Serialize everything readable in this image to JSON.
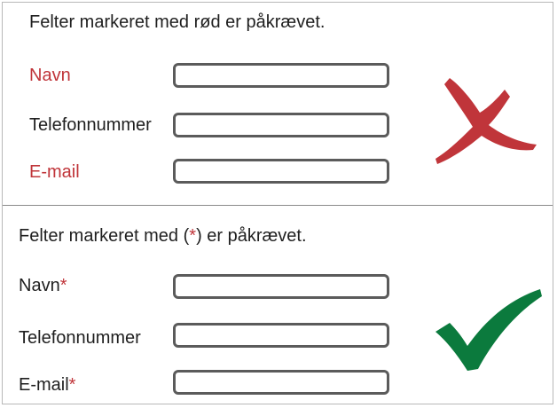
{
  "colors": {
    "required_red": "#c0353a",
    "field_border": "#5b5b5b",
    "cross_red": "#c0353a",
    "check_green": "#0b7a3d"
  },
  "top_example": {
    "heading": "Felter markeret med rød er påkrævet.",
    "fields": [
      {
        "label": "Navn",
        "required": true
      },
      {
        "label": "Telefonnummer",
        "required": false
      },
      {
        "label": "E-mail",
        "required": true
      }
    ],
    "verdict_icon": "red-cross-icon"
  },
  "bottom_example": {
    "heading_before": "Felter markeret med (",
    "heading_asterisk": "*",
    "heading_after": ") er påkrævet.",
    "fields": [
      {
        "label": "Navn",
        "required": true,
        "asterisk": "*"
      },
      {
        "label": "Telefonnummer",
        "required": false,
        "asterisk": ""
      },
      {
        "label": "E-mail",
        "required": true,
        "asterisk": "*"
      }
    ],
    "verdict_icon": "green-check-icon"
  }
}
